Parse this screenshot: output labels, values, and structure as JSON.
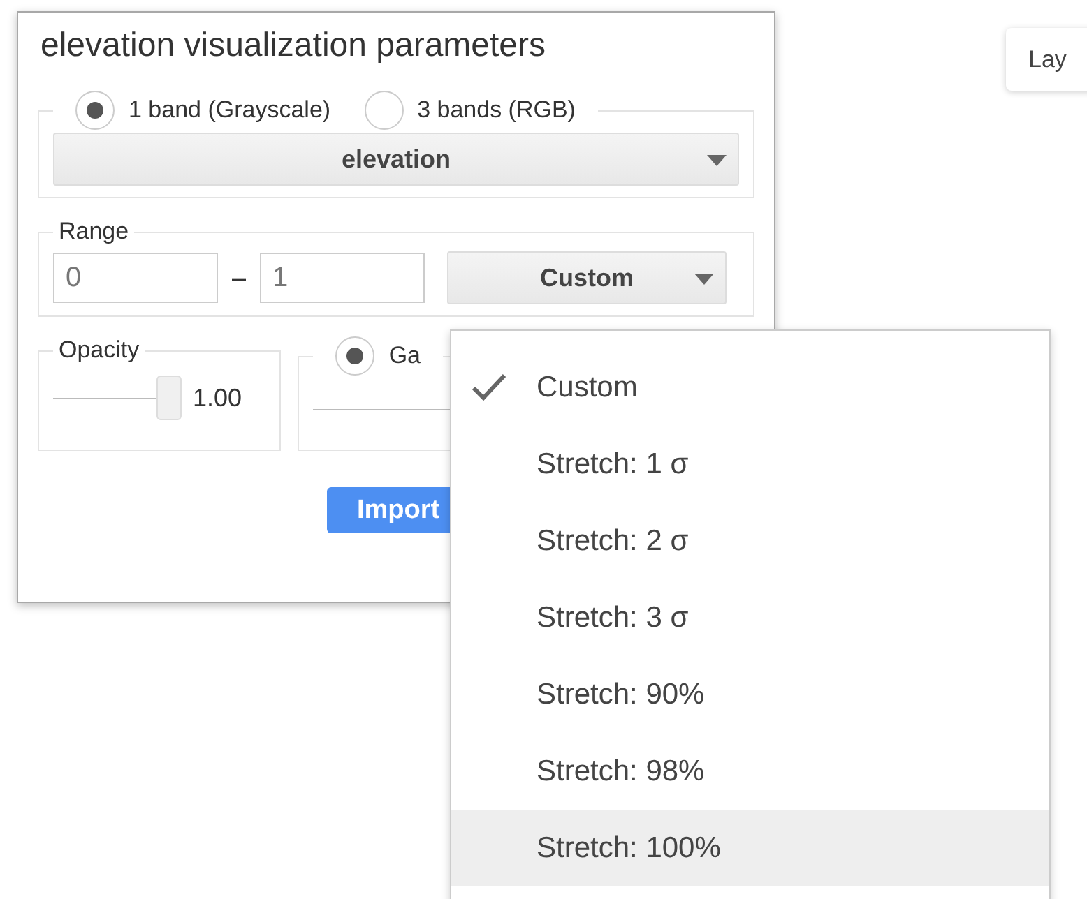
{
  "dialog": {
    "title": "elevation visualization parameters",
    "band_modes": [
      {
        "label": "1 band (Grayscale)",
        "selected": true
      },
      {
        "label": "3 bands (RGB)",
        "selected": false
      }
    ],
    "band_select": {
      "value": "elevation"
    },
    "range": {
      "legend": "Range",
      "min": "0",
      "separator": "–",
      "max": "1",
      "preset": "Custom"
    },
    "opacity": {
      "legend": "Opacity",
      "level": 1,
      "reading": "1.00"
    },
    "gamma": {
      "label": "Ga",
      "selected": true
    },
    "import_button": "Import"
  },
  "range_menu": {
    "items": [
      {
        "label": "Custom",
        "checked": true,
        "highlighted": false
      },
      {
        "label": "Stretch: 1 σ",
        "checked": false,
        "highlighted": false
      },
      {
        "label": "Stretch: 2 σ",
        "checked": false,
        "highlighted": false
      },
      {
        "label": "Stretch: 3 σ",
        "checked": false,
        "highlighted": false
      },
      {
        "label": "Stretch: 90%",
        "checked": false,
        "highlighted": false
      },
      {
        "label": "Stretch: 98%",
        "checked": false,
        "highlighted": false
      },
      {
        "label": "Stretch: 100%",
        "checked": false,
        "highlighted": true
      }
    ]
  },
  "layers_button": "Lay"
}
